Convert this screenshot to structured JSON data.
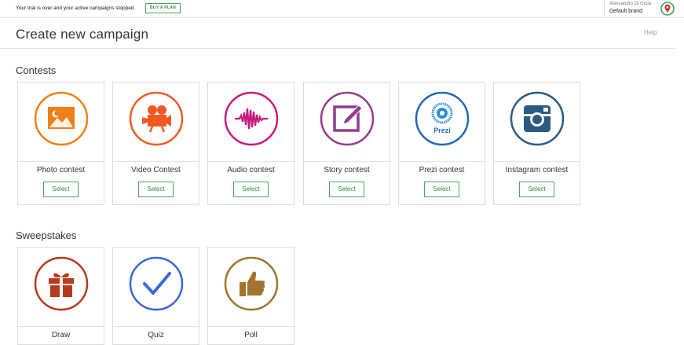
{
  "topbar": {
    "trial_message": "Your trial is over and your active campaigns stopped.",
    "buy_plan_label": "BUY A PLAN",
    "user_name": "Alessandro Di Gioia",
    "brand_name": "Default brand"
  },
  "page": {
    "title": "Create new campaign",
    "help_label": "Help"
  },
  "contests": {
    "section_title": "Contests",
    "select_label": "Select",
    "items": [
      {
        "label": "Photo contest",
        "icon": "photo-icon",
        "color": "#f07f19"
      },
      {
        "label": "Video Contest",
        "icon": "video-camera-icon",
        "color": "#f05a22"
      },
      {
        "label": "Audio contest",
        "icon": "audio-wave-icon",
        "color": "#c8197d"
      },
      {
        "label": "Story contest",
        "icon": "pencil-edit-icon",
        "color": "#943a8f"
      },
      {
        "label": "Prezi contest",
        "icon": "prezi-icon",
        "color": "#2469b3"
      },
      {
        "label": "Instagram contest",
        "icon": "instagram-icon",
        "color": "#2b5a83"
      }
    ]
  },
  "sweepstakes": {
    "section_title": "Sweepstakes",
    "items": [
      {
        "label": "Draw",
        "icon": "gift-icon",
        "color": "#b73a1c"
      },
      {
        "label": "Quiz",
        "icon": "checkmark-icon",
        "color": "#3b68d9"
      },
      {
        "label": "Poll",
        "icon": "thumbs-up-icon",
        "color": "#a2742c"
      }
    ]
  },
  "logo_color": "#3aa655",
  "logo_accent": "#d6342b"
}
